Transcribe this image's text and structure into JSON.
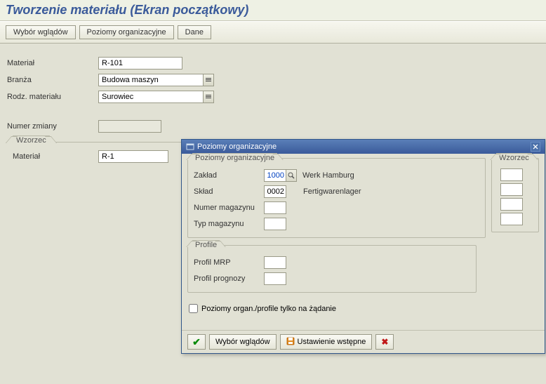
{
  "title": "Tworzenie materiału (Ekran początkowy)",
  "toolbar": {
    "views_btn": "Wybór wglądów",
    "org_btn": "Poziomy organizacyjne",
    "data_btn": "Dane"
  },
  "form": {
    "material_label": "Materiał",
    "material_value": "R-101",
    "industry_label": "Branża",
    "industry_value": "Budowa maszyn",
    "mat_type_label": "Rodz. materiału",
    "mat_type_value": "Surowiec",
    "change_no_label": "Numer zmiany",
    "change_no_value": ""
  },
  "ref_group": {
    "title": "Wzorzec",
    "material_label": "Materiał",
    "material_value": "R-1"
  },
  "dialog": {
    "title": "Poziomy organizacyjne",
    "org_group": {
      "title": "Poziomy organizacyjne",
      "plant_label": "Zakład",
      "plant_value": "1000",
      "plant_desc": "Werk Hamburg",
      "sloc_label": "Skład",
      "sloc_value": "0002",
      "sloc_desc": "Fertigwarenlager",
      "wh_no_label": "Numer magazynu",
      "wh_no_value": "",
      "wh_type_label": "Typ magazynu",
      "wh_type_value": ""
    },
    "ref_group_title": "Wzorzec",
    "profile_group": {
      "title": "Profile",
      "mrp_label": "Profil MRP",
      "mrp_value": "",
      "fcst_label": "Profil prognozy",
      "fcst_value": ""
    },
    "checkbox_label": "Poziomy organ./profile tylko na żądanie",
    "buttons": {
      "views": "Wybór wglądów",
      "default": "Ustawienie wstępne"
    }
  }
}
